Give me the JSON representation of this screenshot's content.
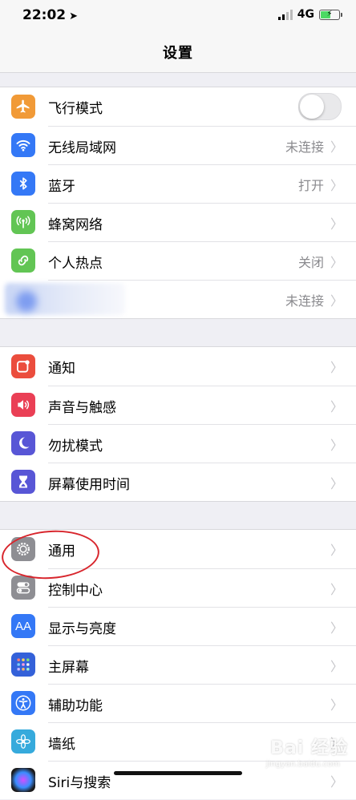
{
  "status_bar": {
    "time": "22:02",
    "network": "4G"
  },
  "nav": {
    "title": "设置"
  },
  "colors": {
    "airplane": "#f19a37",
    "wifi": "#3478f6",
    "bluetooth": "#3478f6",
    "cellular": "#62c554",
    "hotspot": "#62c554",
    "notifications": "#eb4d3d",
    "sounds": "#ea3f55",
    "dnd": "#5856d6",
    "screentime": "#5856d6",
    "general": "#8e8e93",
    "control": "#8e8e93",
    "display": "#3478f6",
    "homescreen": "#3461d9",
    "accessibility": "#3478f6",
    "wallpaper": "#36aadc",
    "siri": "#1c1c1e",
    "annotation": "#d8262d"
  },
  "group1": [
    {
      "label": "飞行模式",
      "icon": "airplane-icon",
      "toggle_on": false
    },
    {
      "label": "无线局域网",
      "icon": "wifi-icon",
      "value": "未连接"
    },
    {
      "label": "蓝牙",
      "icon": "bluetooth-icon",
      "value": "打开"
    },
    {
      "label": "蜂窝网络",
      "icon": "cellular-icon",
      "value": ""
    },
    {
      "label": "个人热点",
      "icon": "hotspot-icon",
      "value": "关闭"
    },
    {
      "label": "",
      "icon": "vpn-icon",
      "value": "未连接"
    }
  ],
  "group2": [
    {
      "label": "通知",
      "icon": "notifications-icon"
    },
    {
      "label": "声音与触感",
      "icon": "speaker-icon"
    },
    {
      "label": "勿扰模式",
      "icon": "moon-icon"
    },
    {
      "label": "屏幕使用时间",
      "icon": "hourglass-icon"
    }
  ],
  "group3": [
    {
      "label": "通用",
      "icon": "gear-icon"
    },
    {
      "label": "控制中心",
      "icon": "switches-icon"
    },
    {
      "label": "显示与亮度",
      "icon": "display-aa-icon"
    },
    {
      "label": "主屏幕",
      "icon": "home-grid-icon"
    },
    {
      "label": "辅助功能",
      "icon": "accessibility-icon"
    },
    {
      "label": "墙纸",
      "icon": "flower-icon"
    },
    {
      "label": "Siri与搜索",
      "icon": "siri-icon"
    }
  ],
  "icons_text": {
    "display_aa": "AA"
  },
  "watermark": {
    "brand": "Bai 经验",
    "url": "jingyan.baidu.com"
  }
}
